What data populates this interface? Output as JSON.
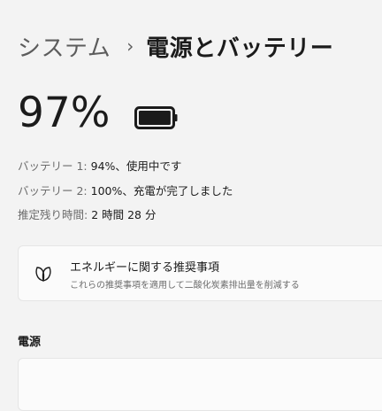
{
  "header": {
    "parent": "システム",
    "separator": "›",
    "current": "電源とバッテリー"
  },
  "battery": {
    "percent_text": "97%",
    "level_percent": 97,
    "battery1_label": "バッテリー 1:",
    "battery1_value": "94%、使用中です",
    "battery2_label": "バッテリー 2:",
    "battery2_value": "100%、充電が完了しました",
    "remaining_label": "推定残り時間:",
    "remaining_value": "2 時間 28 分"
  },
  "recommendation": {
    "icon": "leaf-icon",
    "title": "エネルギーに関する推奨事項",
    "subtitle": "これらの推奨事項を適用して二酸化炭素排出量を削減する"
  },
  "power_section": {
    "header": "電源"
  }
}
